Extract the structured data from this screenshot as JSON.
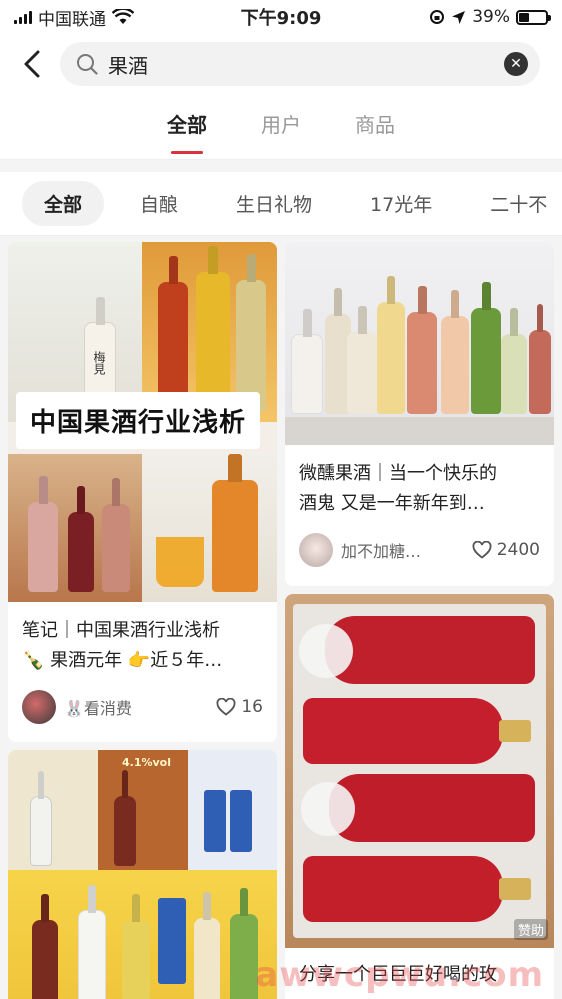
{
  "status_bar": {
    "carrier": "中国联通",
    "time": "下午9:09",
    "battery": "39%",
    "battery_level": 0.39
  },
  "search": {
    "query": "果酒"
  },
  "tabs": [
    {
      "label": "全部"
    },
    {
      "label": "用户"
    },
    {
      "label": "商品"
    }
  ],
  "chips": [
    {
      "label": "全部"
    },
    {
      "label": "自酿"
    },
    {
      "label": "生日礼物"
    },
    {
      "label": "17光年"
    },
    {
      "label": "二十不"
    }
  ],
  "cards": [
    {
      "overlay": "中国果酒行业浅析",
      "title_line1": "笔记｜中国果酒行业浅析",
      "title_line2": "🍾 果酒元年 👉近５年…",
      "author": "🐰看消费",
      "likes": "16",
      "bottle_label": "梅見"
    },
    {
      "title_line1": "微醺果酒｜当一个快乐的",
      "title_line2": "酒鬼 又是一年新年到…",
      "author": "加不加糖…",
      "likes": "2400"
    },
    {
      "sponsor": "赞助",
      "title_line1": "分享一个巨巨巨好喝的玫"
    },
    {
      "badge": "4.1%vol"
    }
  ],
  "watermark": "awwcpwu.com",
  "colors": {
    "accent": "#d8323a"
  }
}
